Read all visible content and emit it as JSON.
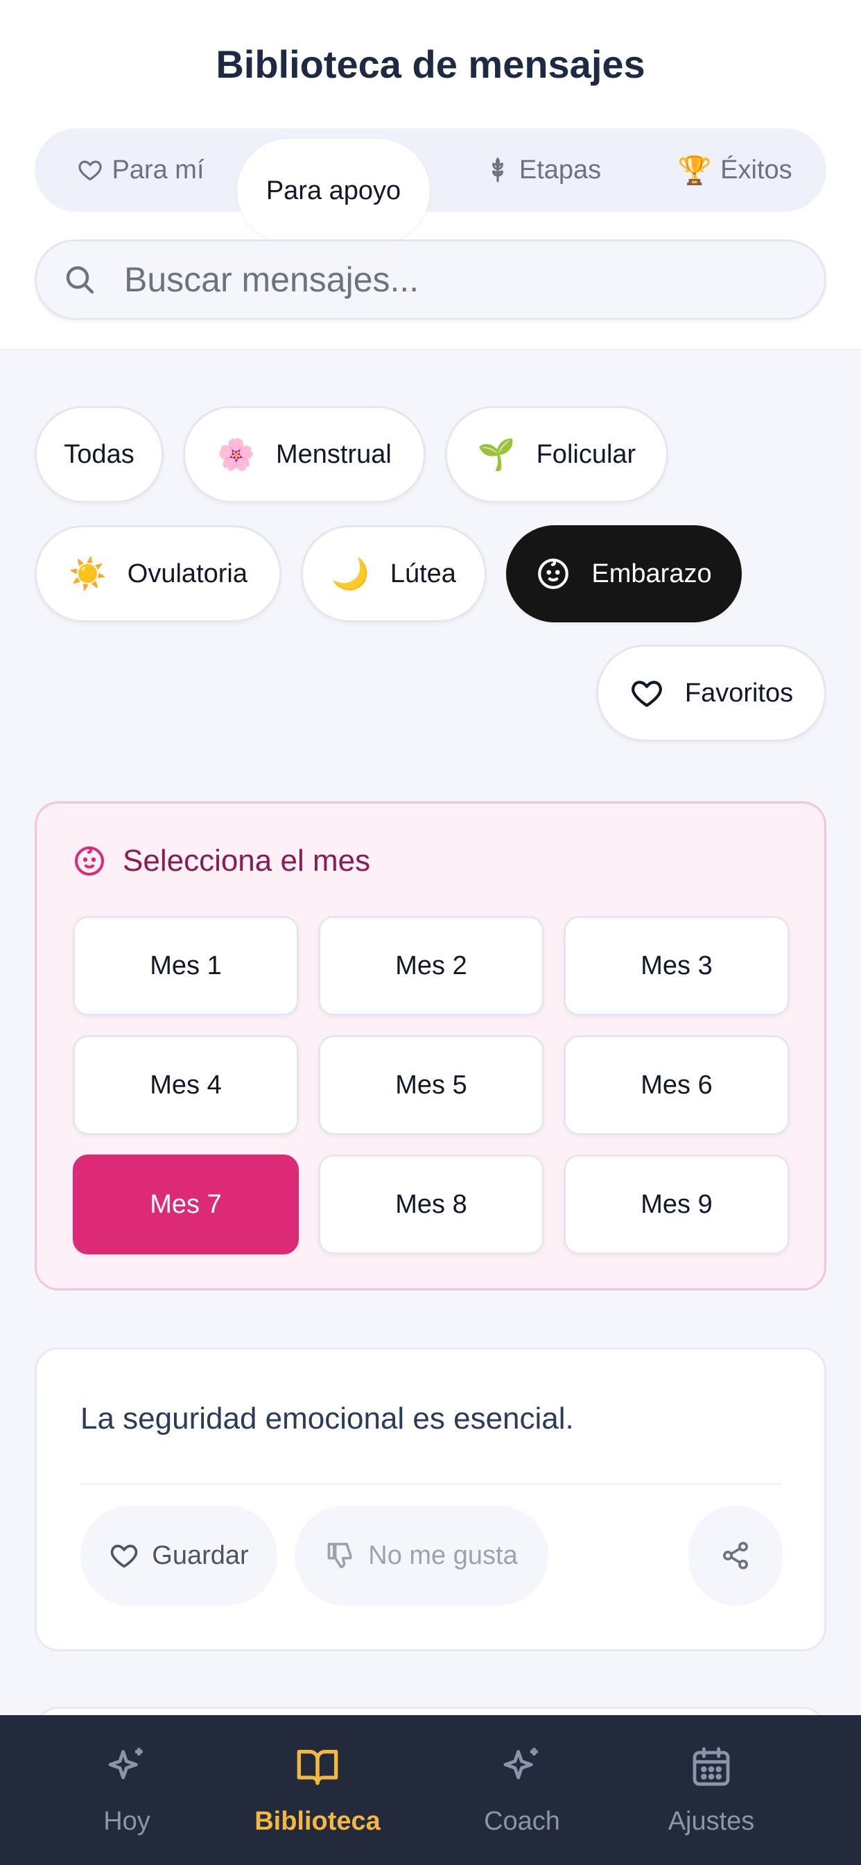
{
  "header": {
    "title": "Biblioteca de mensajes"
  },
  "tabs": [
    {
      "label": "Para mí",
      "icon": "heart-outline-icon"
    },
    {
      "label": "Para apoyo",
      "active": true
    },
    {
      "label": "Etapas",
      "icon": "flower-icon"
    },
    {
      "label": "Éxitos",
      "emoji": "🏆"
    }
  ],
  "search": {
    "placeholder": "Buscar mensajes..."
  },
  "filters": [
    {
      "label": "Todas"
    },
    {
      "label": "Menstrual",
      "emoji": "🌸"
    },
    {
      "label": "Folicular",
      "emoji": "🌱"
    },
    {
      "label": "Ovulatoria",
      "emoji": "☀️"
    },
    {
      "label": "Lútea",
      "emoji": "🌙"
    },
    {
      "label": "Embarazo",
      "icon": "baby-face-icon",
      "active": true
    },
    {
      "label": "Favoritos",
      "icon": "heart-outline-icon"
    }
  ],
  "month_selector": {
    "title": "Selecciona el mes",
    "months": [
      "Mes 1",
      "Mes 2",
      "Mes 3",
      "Mes 4",
      "Mes 5",
      "Mes 6",
      "Mes 7",
      "Mes 8",
      "Mes 9"
    ],
    "selected": "Mes 7"
  },
  "message_card": {
    "text": "La seguridad emocional es esencial.",
    "save_label": "Guardar",
    "dislike_label": "No me gusta"
  },
  "bottom_nav": [
    {
      "label": "Hoy",
      "icon": "sparkles-icon"
    },
    {
      "label": "Biblioteca",
      "icon": "open-book-icon",
      "active": true
    },
    {
      "label": "Coach",
      "icon": "sparkles-icon"
    },
    {
      "label": "Ajustes",
      "icon": "calendar-icon"
    }
  ],
  "colors": {
    "accent_pink": "#dc2a76",
    "active_chip": "#151515",
    "nav_background": "#222a3c",
    "nav_active": "#f4b73f",
    "title": "#1e2a44"
  }
}
